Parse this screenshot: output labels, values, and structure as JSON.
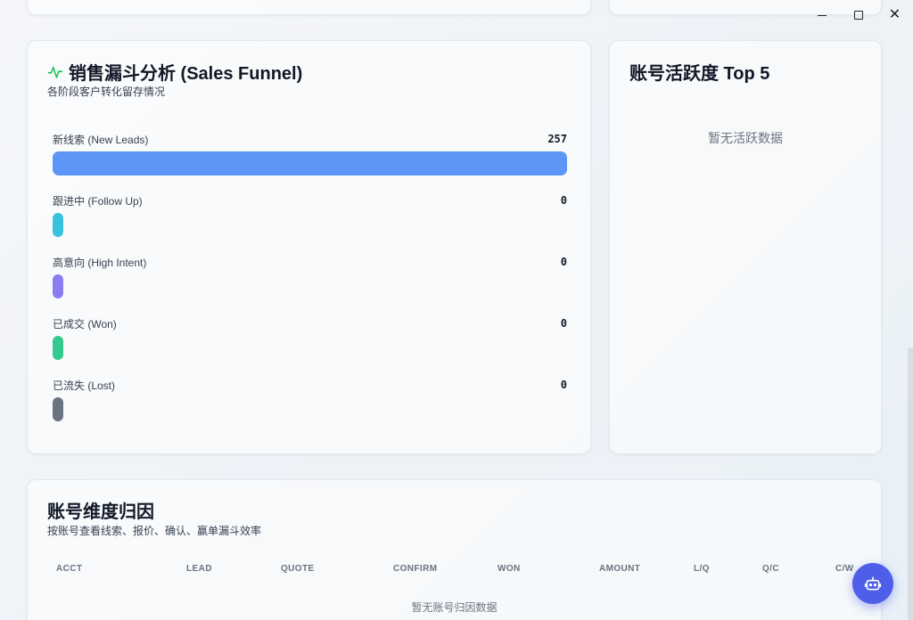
{
  "window": {
    "minimize_icon": "minimize-icon",
    "maximize_icon": "maximize-icon",
    "close_icon": "close-icon"
  },
  "funnel": {
    "title": "销售漏斗分析 (Sales Funnel)",
    "subtitle": "各阶段客户转化留存情况",
    "stages": [
      {
        "label": "新线索 (New Leads)",
        "count": "257",
        "fraction": 1.0,
        "color": "#5b95f5"
      },
      {
        "label": "跟进中 (Follow Up)",
        "count": "0",
        "fraction": 0,
        "color": "#38c2de"
      },
      {
        "label": "高意向 (High Intent)",
        "count": "0",
        "fraction": 0,
        "color": "#8b7cf0"
      },
      {
        "label": "已成交 (Won)",
        "count": "0",
        "fraction": 0,
        "color": "#34c98d"
      },
      {
        "label": "已流失 (Lost)",
        "count": "0",
        "fraction": 0,
        "color": "#6b7280"
      }
    ]
  },
  "active": {
    "title": "账号活跃度 Top 5",
    "empty": "暂无活跃数据"
  },
  "attribution": {
    "title": "账号维度归因",
    "subtitle": "按账号查看线索、报价、确认、赢单漏斗效率",
    "columns": [
      "ACCT",
      "LEAD",
      "QUOTE",
      "CONFIRM",
      "WON",
      "AMOUNT",
      "L/Q",
      "Q/C",
      "C/W"
    ],
    "empty": "暂无账号归因数据"
  },
  "fab": {
    "icon": "robot-icon"
  }
}
